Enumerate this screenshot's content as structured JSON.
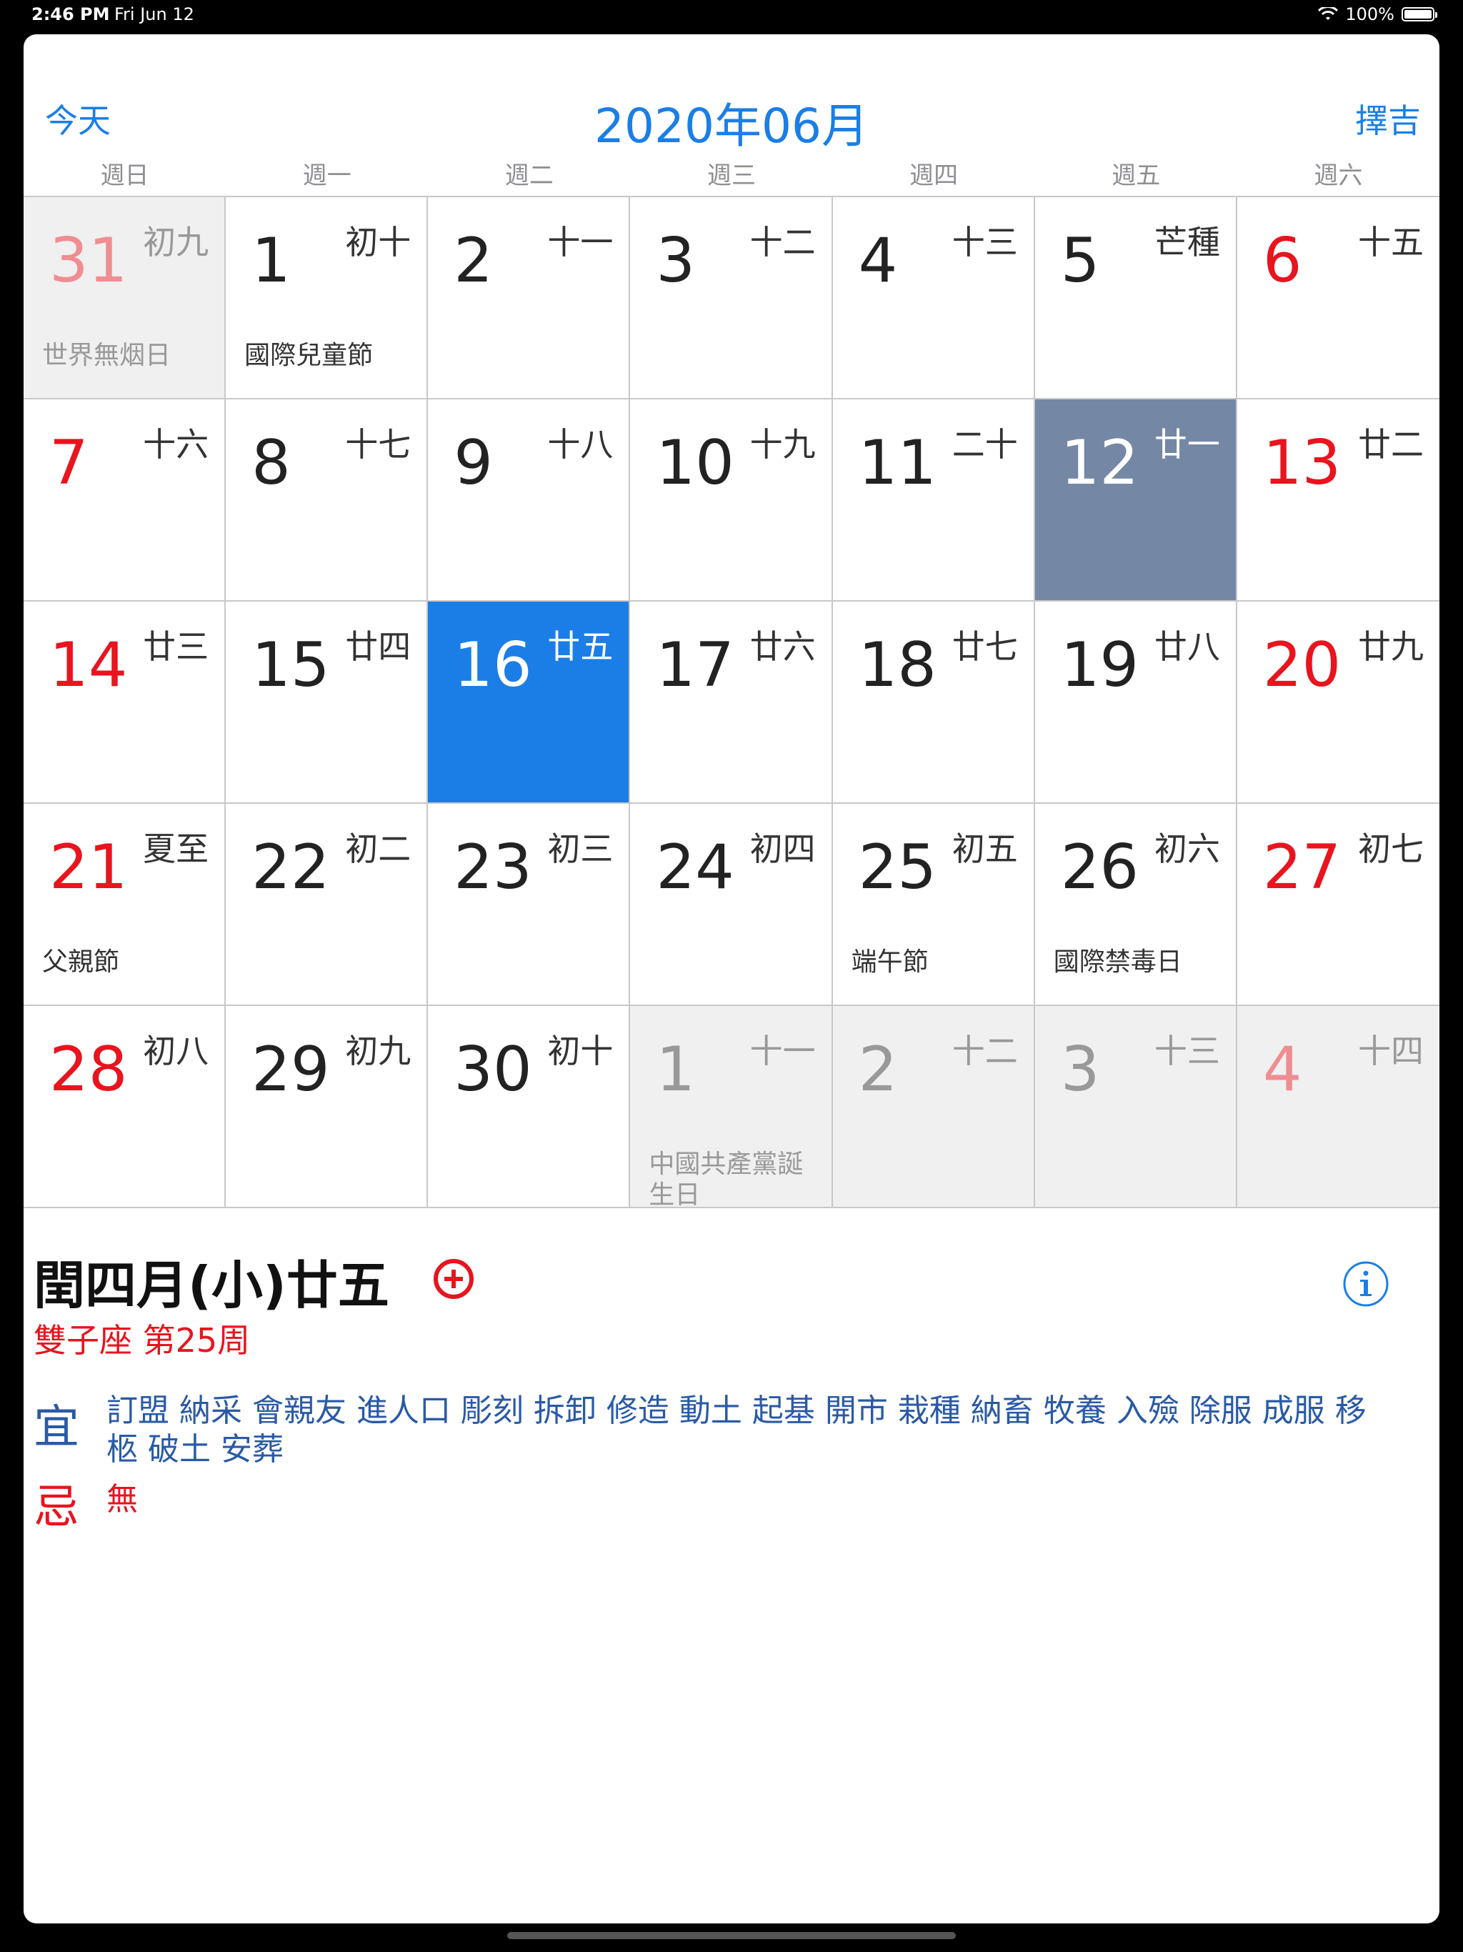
{
  "status": {
    "time": "2:46 PM",
    "date": "Fri Jun 12",
    "battery": "100%"
  },
  "header": {
    "today": "今天",
    "title": "2020年06月",
    "select_auspicious": "擇吉"
  },
  "weekdays": [
    "週日",
    "週一",
    "週二",
    "週三",
    "週四",
    "週五",
    "週六"
  ],
  "weeks": [
    [
      {
        "day": "31",
        "lunar": "初九",
        "festival": "世界無烟日",
        "other": true
      },
      {
        "day": "1",
        "lunar": "初十",
        "festival": "國際兒童節"
      },
      {
        "day": "2",
        "lunar": "十一"
      },
      {
        "day": "3",
        "lunar": "十二"
      },
      {
        "day": "4",
        "lunar": "十三"
      },
      {
        "day": "5",
        "lunar": "芒種"
      },
      {
        "day": "6",
        "lunar": "十五"
      }
    ],
    [
      {
        "day": "7",
        "lunar": "十六"
      },
      {
        "day": "8",
        "lunar": "十七"
      },
      {
        "day": "9",
        "lunar": "十八"
      },
      {
        "day": "10",
        "lunar": "十九"
      },
      {
        "day": "11",
        "lunar": "二十"
      },
      {
        "day": "12",
        "lunar": "廿一",
        "selected": true
      },
      {
        "day": "13",
        "lunar": "廿二"
      }
    ],
    [
      {
        "day": "14",
        "lunar": "廿三"
      },
      {
        "day": "15",
        "lunar": "廿四"
      },
      {
        "day": "16",
        "lunar": "廿五",
        "today": true
      },
      {
        "day": "17",
        "lunar": "廿六"
      },
      {
        "day": "18",
        "lunar": "廿七"
      },
      {
        "day": "19",
        "lunar": "廿八"
      },
      {
        "day": "20",
        "lunar": "廿九"
      }
    ],
    [
      {
        "day": "21",
        "lunar": "夏至",
        "festival": "父親節"
      },
      {
        "day": "22",
        "lunar": "初二"
      },
      {
        "day": "23",
        "lunar": "初三"
      },
      {
        "day": "24",
        "lunar": "初四"
      },
      {
        "day": "25",
        "lunar": "初五",
        "festival": "端午節"
      },
      {
        "day": "26",
        "lunar": "初六",
        "festival": "國際禁毒日"
      },
      {
        "day": "27",
        "lunar": "初七"
      }
    ],
    [
      {
        "day": "28",
        "lunar": "初八"
      },
      {
        "day": "29",
        "lunar": "初九"
      },
      {
        "day": "30",
        "lunar": "初十"
      },
      {
        "day": "1",
        "lunar": "十一",
        "festival": "中國共產黨誕生日",
        "other": true
      },
      {
        "day": "2",
        "lunar": "十二",
        "other": true
      },
      {
        "day": "3",
        "lunar": "十三",
        "other": true
      },
      {
        "day": "4",
        "lunar": "十四",
        "other": true
      }
    ]
  ],
  "details": {
    "title": "閏四月(小)廿五",
    "subtitle": "雙子座 第25周",
    "yi_label": "宜",
    "yi": "訂盟 納采 會親友 進人口 彫刻 拆卸 修造 動土 起基 開市 栽種 納畜 牧養 入殮 除服 成服 移柩 破土 安葬",
    "ji_label": "忌",
    "ji": "無"
  },
  "colors": {
    "accent": "#1a7ee6",
    "weekend": "#e8141e",
    "selected": "#7488a6",
    "yi": "#2a5aa6"
  }
}
